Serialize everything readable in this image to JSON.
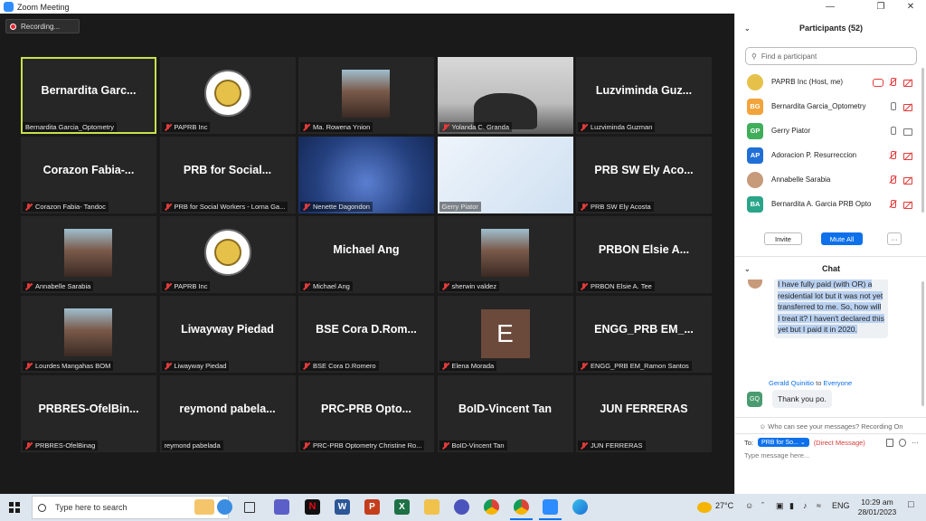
{
  "window": {
    "title": "Zoom Meeting"
  },
  "recording": {
    "label": "Recording..."
  },
  "tiles": [
    {
      "big": "Bernardita Garc...",
      "label": "Bernardita Garcia_Optometry",
      "muted": false,
      "active": true,
      "visual": "name"
    },
    {
      "big": "",
      "label": "PAPRB Inc",
      "muted": true,
      "visual": "logo"
    },
    {
      "big": "",
      "label": "Ma. Rowena Ynion",
      "muted": true,
      "visual": "photo"
    },
    {
      "big": "",
      "label": "Yolanda C. Granda",
      "muted": true,
      "visual": "camera"
    },
    {
      "big": "Luzviminda Guz...",
      "label": "Luzviminda Guzman",
      "muted": true,
      "visual": "name"
    },
    {
      "big": "Corazon Fabia-...",
      "label": "Corazon Fabia- Tandoc",
      "muted": true,
      "visual": "name"
    },
    {
      "big": "PRB for Social...",
      "label": "PRB for Social Workers - Lorna Ga...",
      "muted": true,
      "visual": "name"
    },
    {
      "big": "",
      "label": "Nenette Dagondon",
      "muted": true,
      "visual": "share-blue"
    },
    {
      "big": "",
      "label": "Gerry Piator",
      "muted": false,
      "visual": "share-light"
    },
    {
      "big": "PRB SW Ely Aco...",
      "label": "PRB SW Ely Acosta",
      "muted": true,
      "visual": "name"
    },
    {
      "big": "",
      "label": "Annabelle Sarabia",
      "muted": true,
      "visual": "photo"
    },
    {
      "big": "",
      "label": "PAPRB Inc",
      "muted": true,
      "visual": "logo"
    },
    {
      "big": "Michael Ang",
      "label": "Michael Ang",
      "muted": true,
      "visual": "name"
    },
    {
      "big": "",
      "label": "sherwin valdez",
      "muted": true,
      "visual": "photo"
    },
    {
      "big": "PRBON Elsie A...",
      "label": "PRBON Elsie A. Tee",
      "muted": true,
      "visual": "name"
    },
    {
      "big": "",
      "label": "Lourdes Mangahas BOM",
      "muted": true,
      "visual": "photo"
    },
    {
      "big": "Liwayway Piedad",
      "label": "Liwayway Piedad",
      "muted": true,
      "visual": "name"
    },
    {
      "big": "BSE Cora D.Rom...",
      "label": "BSE Cora D.Romero",
      "muted": true,
      "visual": "name"
    },
    {
      "big": "E",
      "label": "Elena Morada",
      "muted": true,
      "visual": "letter"
    },
    {
      "big": "ENGG_PRB EM_...",
      "label": "ENGG_PRB EM_Ramon Santos",
      "muted": true,
      "visual": "name"
    },
    {
      "big": "PRBRES-OfelBin...",
      "label": "PRBRES-OfelBinag",
      "muted": true,
      "visual": "name"
    },
    {
      "big": "reymond pabela...",
      "label": "reymond pabelada",
      "muted": false,
      "visual": "name"
    },
    {
      "big": "PRC-PRB Opto...",
      "label": "PRC-PRB Optometry Christine Ro...",
      "muted": true,
      "visual": "name"
    },
    {
      "big": "BoID-Vincent Tan",
      "label": "BoID-Vincent Tan",
      "muted": true,
      "visual": "name"
    },
    {
      "big": "JUN FERRERAS",
      "label": "JUN FERRERAS",
      "muted": true,
      "visual": "name"
    }
  ],
  "participants": {
    "header": "Participants (52)",
    "search_placeholder": "Find a participant",
    "items": [
      {
        "initials": "",
        "name": "PAPRB Inc (Host, me)",
        "color": "#e6c14a",
        "icons": [
          "rec-red",
          "mic-red",
          "vid-red"
        ]
      },
      {
        "initials": "BG",
        "name": "Bernardita Garcia_Optometry",
        "color": "#f2a33a",
        "icons": [
          "mic-gray",
          "vid-red"
        ]
      },
      {
        "initials": "GP",
        "name": "Gerry Piator",
        "color": "#3fae5a",
        "icons": [
          "mic-gray",
          "vid-gray"
        ]
      },
      {
        "initials": "AP",
        "name": "Adoracion P. Resurreccion",
        "color": "#1f6fd6",
        "icons": [
          "mic-red",
          "vid-red"
        ]
      },
      {
        "initials": "",
        "name": "Annabelle Sarabia",
        "color": "#c79a7a",
        "icons": [
          "mic-red",
          "vid-red"
        ]
      },
      {
        "initials": "BA",
        "name": "Bernardita A. Garcia PRB Opto",
        "color": "#2aa58a",
        "icons": [
          "mic-red",
          "vid-red"
        ]
      }
    ],
    "invite_label": "Invite",
    "mute_all_label": "Mute All",
    "more_label": "···"
  },
  "chat": {
    "header": "Chat",
    "prev_message": "I have fully paid (with OR) a residential lot but it was not yet transferred to me. So, how will I treat it? I haven't declared this yet but I paid it in 2020.",
    "sender": "Gerald Quinitio",
    "to_word": "to",
    "recipient": "Everyone",
    "sender_initials": "GQ",
    "message": "Thank you po.",
    "who_can_see": "Who can see your messages? Recording On",
    "to_label": "To:",
    "to_chip": "PRB for So...",
    "direct_label": "(Direct Message)",
    "placeholder": "Type message here..."
  },
  "taskbar": {
    "search_placeholder": "Type here to search",
    "temperature": "27°C",
    "language": "ENG",
    "time": "10:29 am",
    "date": "28/01/2023"
  }
}
